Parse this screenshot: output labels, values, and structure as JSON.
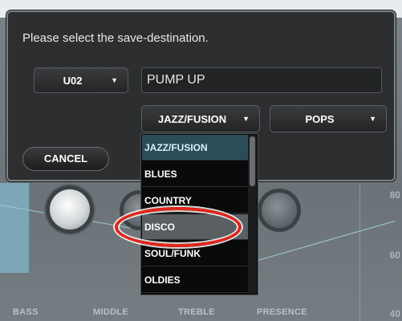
{
  "dialog": {
    "title": "Please select the save-destination.",
    "slot_label": "U02",
    "name_value": "PUMP UP",
    "category_label": "JAZZ/FUSION",
    "subcategory_label": "POPS",
    "cancel_label": "CANCEL"
  },
  "dropdown": {
    "items": [
      "JAZZ/FUSION",
      "BLUES",
      "COUNTRY",
      "DISCO",
      "SOUL/FUNK",
      "OLDIES"
    ],
    "selected_index": 0,
    "highlighted_index": 3
  },
  "background": {
    "top_text": "",
    "labels": [
      "BASS",
      "MIDDLE",
      "TREBLE",
      "PRESENCE"
    ],
    "scale": [
      "80",
      "60",
      "40"
    ]
  },
  "colors": {
    "dialog_bg": "#2c2e30",
    "selected_item_bg": "#2a4d5a",
    "highlight_ring": "#e1261c"
  }
}
